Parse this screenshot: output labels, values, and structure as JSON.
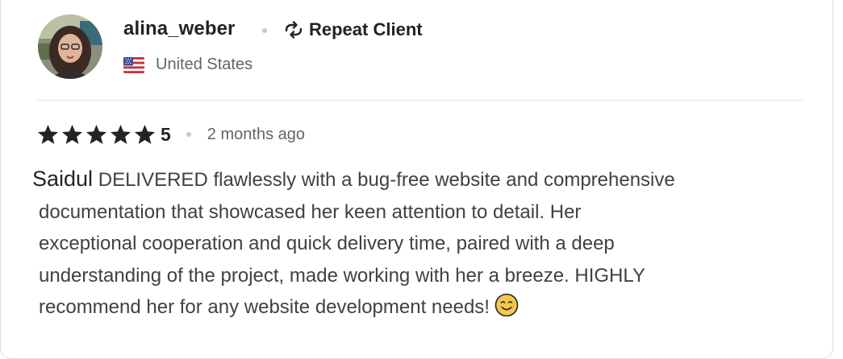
{
  "reviewer": {
    "username": "alina_weber",
    "badge_label": "Repeat Client",
    "badge_icon": "repeat-icon",
    "country": "United States",
    "country_flag": "us-flag-icon",
    "avatar": "avatar-photo"
  },
  "review": {
    "rating": "5",
    "stars": 5,
    "time_ago": "2 months ago",
    "author_name": "Saidul",
    "lines": [
      " DELIVERED flawlessly with a bug-free website and comprehensive",
      "documentation that showcased her keen attention to detail. Her",
      "exceptional cooperation and quick delivery time, paired with a deep",
      "understanding of the project, made working with her a breeze. HIGHLY",
      "recommend her for any website development needs!"
    ],
    "emoji": "smiling-face-icon"
  },
  "colors": {
    "text_primary": "#222325",
    "text_secondary": "#62646a",
    "body_text": "#404145",
    "border": "#dadbdd",
    "star": "#222325",
    "emoji": "#f7c94a"
  }
}
